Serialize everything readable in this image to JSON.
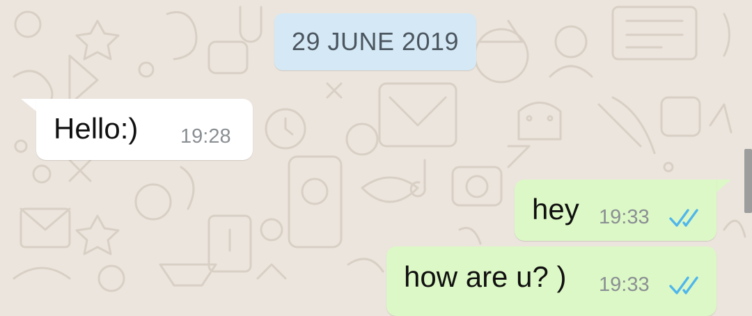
{
  "chat": {
    "date_divider": "29 JUNE 2019",
    "messages": [
      {
        "direction": "incoming",
        "text": "Hello:)",
        "time": "19:28"
      },
      {
        "direction": "outgoing",
        "text": "hey",
        "time": "19:33",
        "status": "read"
      },
      {
        "direction": "outgoing",
        "text": "how are u? )",
        "time": "19:33",
        "status": "read"
      }
    ]
  },
  "colors": {
    "background": "#ece5dd",
    "incoming_bubble": "#ffffff",
    "outgoing_bubble": "#dcf8c6",
    "date_chip": "#d4e9f5",
    "read_ticks": "#4fb6ec"
  },
  "icons": {
    "read_status": "double-check-icon",
    "wallpaper": "doodle-pattern"
  }
}
